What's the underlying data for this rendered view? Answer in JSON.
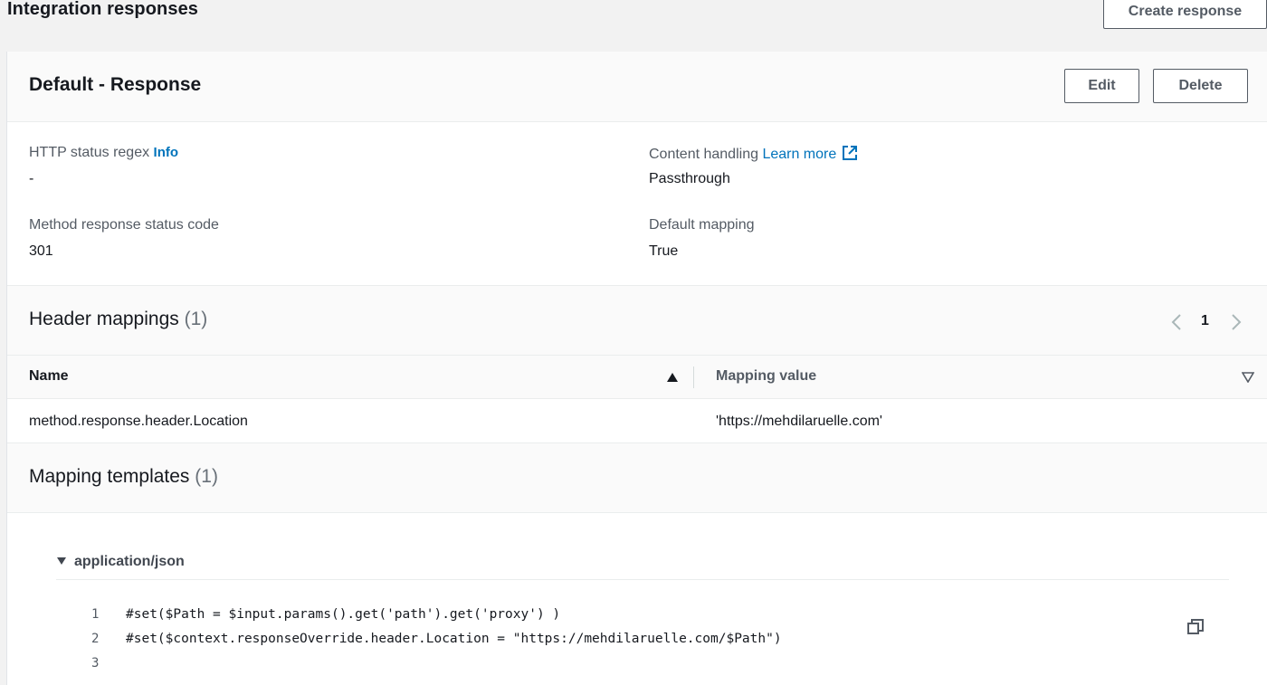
{
  "header": {
    "title": "Integration responses",
    "create_label": "Create response"
  },
  "response": {
    "title": "Default - Response",
    "edit_label": "Edit",
    "delete_label": "Delete",
    "fields": {
      "status_regex_label": "HTTP status regex",
      "status_regex_info": "Info",
      "status_regex_value": "-",
      "content_handling_label": "Content handling",
      "content_handling_link": "Learn more",
      "content_handling_value": "Passthrough",
      "method_status_label": "Method response status code",
      "method_status_value": "301",
      "default_mapping_label": "Default mapping",
      "default_mapping_value": "True"
    }
  },
  "header_mappings": {
    "title": "Header mappings",
    "count": "(1)",
    "page": "1",
    "columns": [
      "Name",
      "Mapping value"
    ],
    "rows": [
      {
        "name": "method.response.header.Location",
        "value": "'https://mehdilaruelle.com'"
      }
    ]
  },
  "mapping_templates": {
    "title": "Mapping templates",
    "count": "(1)",
    "content_type": "application/json",
    "lines": [
      {
        "num": "1",
        "code": "#set($Path = $input.params().get('path').get('proxy') )"
      },
      {
        "num": "2",
        "code": "#set($context.responseOverride.header.Location = \"https://mehdilaruelle.com/$Path\")"
      },
      {
        "num": "3",
        "code": ""
      }
    ]
  },
  "icons": {
    "external_link": "external-link-icon",
    "sort_asc": "sort-ascending-icon",
    "sort_desc": "sort-descending-icon",
    "caret_down": "caret-down-icon",
    "copy": "copy-icon",
    "chevron_left": "chevron-left-icon",
    "chevron_right": "chevron-right-icon"
  },
  "colors": {
    "link": "#0073bb",
    "text": "#16191f",
    "muted": "#545b64"
  }
}
